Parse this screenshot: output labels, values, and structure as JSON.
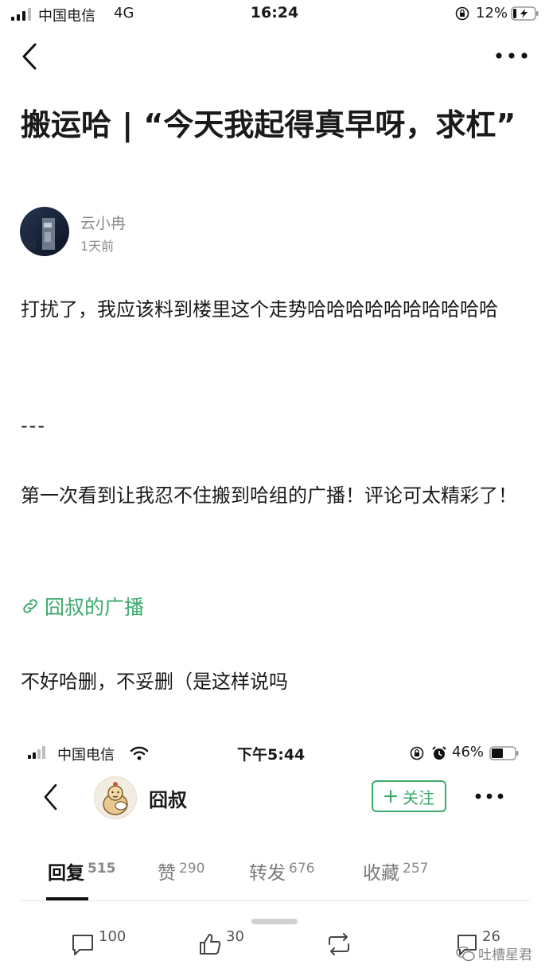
{
  "status_bar": {
    "carrier": "中国电信",
    "network": "4G",
    "time": "16:24",
    "battery": "12%"
  },
  "header": {
    "back_icon": "chevron-left-icon",
    "more_icon": "more-dots-icon"
  },
  "post": {
    "title": "搬运哈 | “今天我起得真早呀，求杠”",
    "author": "云小冉",
    "time": "1天前",
    "paragraphs": {
      "p1": "打扰了，我应该料到楼里这个走势哈哈哈哈哈哈哈哈哈哈",
      "p2": "---",
      "p3": "第一次看到让我忍不住搬到哈组的广播！评论可太精彩了！",
      "p4": "不好哈删，不妥删（是这样说吗"
    },
    "link_text": "囧叔的广播"
  },
  "embedded": {
    "status_bar": {
      "carrier": "中国电信",
      "time": "下午5:44",
      "battery": "46%"
    },
    "user_name": "囧叔",
    "follow_label": "关注",
    "tabs": [
      {
        "label": "回复",
        "count": "515"
      },
      {
        "label": "赞",
        "count": "290"
      },
      {
        "label": "转发",
        "count": "676"
      },
      {
        "label": "收藏",
        "count": "257"
      }
    ]
  },
  "bottom_bar": {
    "comments": "100",
    "likes": "30",
    "reshare_icon": "repost-icon",
    "collect": "26"
  },
  "watermark": "吐槽星君",
  "colors": {
    "accent": "#3daa6c",
    "text": "#1a1a1a",
    "muted": "#8c8c8c"
  }
}
